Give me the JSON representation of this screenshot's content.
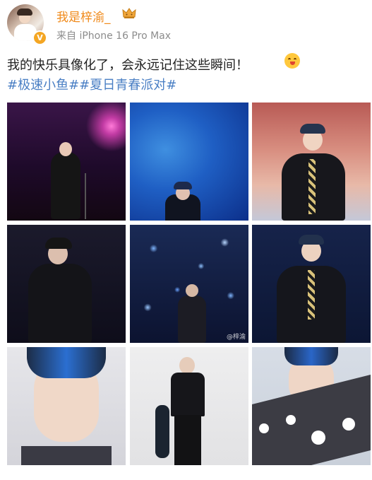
{
  "post": {
    "username": "我是梓渝_",
    "crown_icon": "crown-icon",
    "verified_badge": "V",
    "source": "来自 iPhone 16 Pro Max",
    "text": "我的快乐具像化了，会永远记住这些瞬间！",
    "emoji_icon": "laughing-face-icon",
    "tags": [
      "#极速小鱼#",
      "#夏日青春派对#"
    ],
    "username_color": "#f08a1b",
    "tag_color": "#4a7fc4"
  },
  "photos": {
    "count": 9,
    "watermark": "@梓渝"
  }
}
